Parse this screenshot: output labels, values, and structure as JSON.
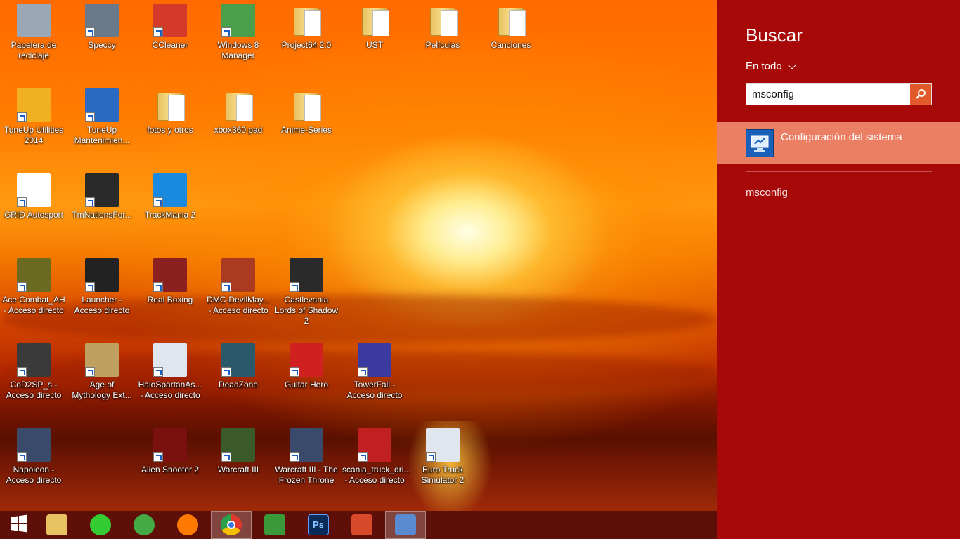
{
  "desktop": {
    "icons": [
      {
        "label": "Papelera de reciclaje",
        "icon": "recycle-bin-icon"
      },
      {
        "label": "Speccy",
        "icon": "speccy-icon"
      },
      {
        "label": "CCleaner",
        "icon": "ccleaner-icon"
      },
      {
        "label": "Windows 8 Manager",
        "icon": "windows8-manager-icon"
      },
      {
        "label": "Project64 2.0",
        "icon": "folder-icon"
      },
      {
        "label": "UST",
        "icon": "folder-icon"
      },
      {
        "label": "Películas",
        "icon": "folder-icon"
      },
      {
        "label": "Canciones",
        "icon": "folder-icon"
      },
      {
        "label": "TuneUp Utilities 2014",
        "icon": "tuneup-utilities-icon"
      },
      {
        "label": "TuneUp Mantenimien...",
        "icon": "tuneup-maintenance-icon"
      },
      {
        "label": "fotos y otros",
        "icon": "folder-icon"
      },
      {
        "label": "xbox360 pad",
        "icon": "folder-icon"
      },
      {
        "label": "Anime-Series",
        "icon": "folder-icon"
      },
      {
        "label": "GRID Autosport",
        "icon": "grid-autosport-icon"
      },
      {
        "label": "TmNationsFor...",
        "icon": "tmnations-icon"
      },
      {
        "label": "TrackMania 2",
        "icon": "trackmania2-icon"
      },
      {
        "label": "Ace Combat_AH - Acceso directo",
        "icon": "ace-combat-icon"
      },
      {
        "label": "Launcher - Acceso directo",
        "icon": "launcher-icon"
      },
      {
        "label": "Real Boxing",
        "icon": "real-boxing-icon"
      },
      {
        "label": "DMC-DevilMay... - Acceso directo",
        "icon": "dmc-icon"
      },
      {
        "label": "Castlevania Lords of Shadow 2",
        "icon": "castlevania-icon"
      },
      {
        "label": "CoD2SP_s - Acceso directo",
        "icon": "cod2-icon"
      },
      {
        "label": "Age of Mythology Ext...",
        "icon": "age-of-mythology-icon"
      },
      {
        "label": "HaloSpartanAs... - Acceso directo",
        "icon": "halo-icon"
      },
      {
        "label": "DeadZone",
        "icon": "deadzone-icon"
      },
      {
        "label": "Guitar Hero",
        "icon": "guitar-hero-icon"
      },
      {
        "label": "TowerFall - Acceso directo",
        "icon": "towerfall-icon"
      },
      {
        "label": "Napoleon - Acceso directo",
        "icon": "napoleon-icon"
      },
      {
        "label": "Alien Shooter 2",
        "icon": "alien-shooter-icon"
      },
      {
        "label": "Warcraft III",
        "icon": "warcraft3-icon"
      },
      {
        "label": "Warcraft III - The Frozen Throne",
        "icon": "warcraft3-frozen-throne-icon"
      },
      {
        "label": "scania_truck_dri... - Acceso directo",
        "icon": "scania-truck-icon"
      },
      {
        "label": "Euro Truck Simulator 2",
        "icon": "euro-truck-icon"
      }
    ]
  },
  "taskbar": {
    "items": [
      {
        "icon": "windows-start-icon",
        "color": "#ffffff"
      },
      {
        "icon": "file-explorer-icon",
        "color": "#e8c260"
      },
      {
        "icon": "razer-game-booster-icon",
        "color": "#33cc33"
      },
      {
        "icon": "xbox-icon",
        "color": "#44aa44"
      },
      {
        "icon": "media-player-icon",
        "color": "#ff7a00"
      },
      {
        "icon": "chrome-icon",
        "color": "#e0392b"
      },
      {
        "icon": "winamp-icon",
        "color": "#3a9a3a"
      },
      {
        "icon": "photoshop-icon",
        "color": "#0a2a5a"
      },
      {
        "icon": "shutdown-icon",
        "color": "#d94a2a"
      },
      {
        "icon": "paint-icon",
        "color": "#5a8ad0"
      }
    ]
  },
  "search_charm": {
    "title": "Buscar",
    "scope": "En todo",
    "query": "msconfig",
    "results": [
      {
        "label": "Configuración del sistema",
        "icon": "system-config-icon"
      }
    ],
    "suggestions": [
      "msconfig"
    ],
    "accent": "#a70909",
    "highlight": "#ea7f64"
  }
}
